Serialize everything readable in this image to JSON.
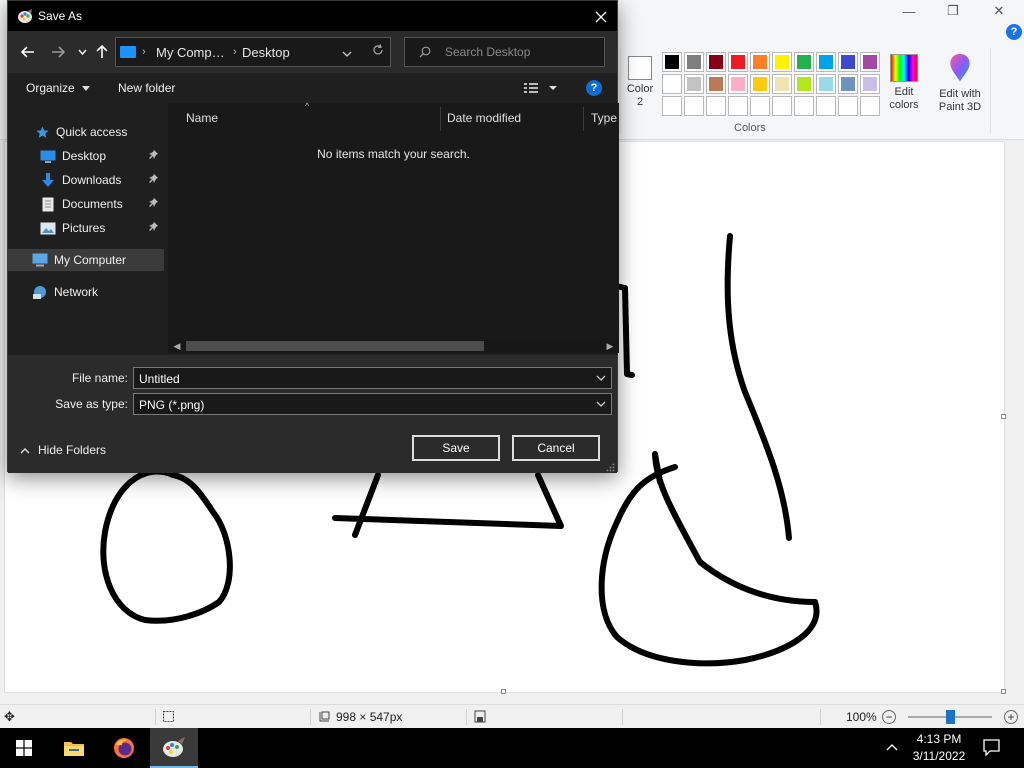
{
  "paint": {
    "window_controls": {
      "minimize": "—",
      "maximize": "❐",
      "close": "✕"
    },
    "help": "?",
    "color2_label": "Color 2",
    "colors_group_label": "Colors",
    "edit_colors_label": "Edit colors",
    "edit_paint3d_label": "Edit with Paint 3D",
    "palette_row1": [
      "#000000",
      "#7f7f7f",
      "#880015",
      "#ed1c24",
      "#ff7f27",
      "#fff200",
      "#22b14c",
      "#00a2e8",
      "#3f48cc",
      "#a349a4"
    ],
    "palette_row2": [
      "#ffffff",
      "#c3c3c3",
      "#b97a57",
      "#ffaec9",
      "#ffc90e",
      "#efe4b0",
      "#b5e61d",
      "#99d9ea",
      "#7092be",
      "#c8bfe7"
    ],
    "palette_row3": [
      "#ffffff",
      "#ffffff",
      "#ffffff",
      "#ffffff",
      "#ffffff",
      "#ffffff",
      "#ffffff",
      "#ffffff",
      "#ffffff",
      "#ffffff"
    ],
    "status": {
      "canvas_size": "998 × 547px",
      "zoom": "100%",
      "zoom_level_percent": 100
    }
  },
  "dialog": {
    "title": "Save As",
    "breadcrumb": [
      "My Comp…",
      "Desktop"
    ],
    "search_placeholder": "Search Desktop",
    "organize_label": "Organize",
    "new_folder_label": "New folder",
    "help": "?",
    "nav": {
      "quick_access": "Quick access",
      "items": [
        {
          "label": "Desktop",
          "icon": "desktop-icon",
          "pinned": true
        },
        {
          "label": "Downloads",
          "icon": "downloads-icon",
          "pinned": true
        },
        {
          "label": "Documents",
          "icon": "documents-icon",
          "pinned": true
        },
        {
          "label": "Pictures",
          "icon": "pictures-icon",
          "pinned": true
        }
      ],
      "my_computer": "My Computer",
      "network": "Network"
    },
    "columns": [
      "Name",
      "Date modified",
      "Type"
    ],
    "empty_message": "No items match your search.",
    "file_name_label": "File name:",
    "file_name_value": "Untitled",
    "save_type_label": "Save as type:",
    "save_type_value": "PNG (*.png)",
    "hide_folders_label": "Hide Folders",
    "save_label": "Save",
    "cancel_label": "Cancel"
  },
  "taskbar": {
    "time": "4:13 PM",
    "date": "3/11/2022",
    "apps": [
      "start-icon",
      "file-explorer-icon",
      "firefox-icon",
      "paint-icon"
    ]
  }
}
